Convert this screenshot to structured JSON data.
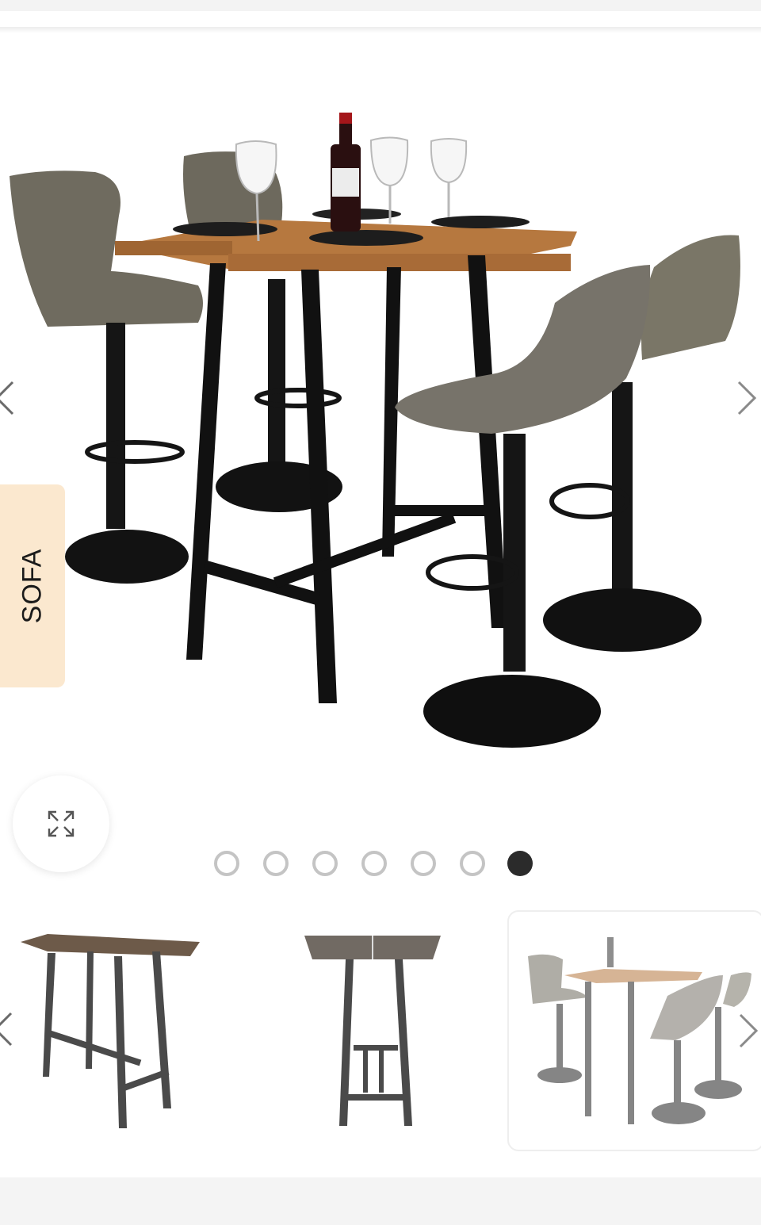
{
  "side_tab": {
    "label": "SOFA"
  },
  "gallery": {
    "total_images": 7,
    "active_index": 6
  },
  "thumbnails": [
    {
      "name": "bar-table-angled"
    },
    {
      "name": "bar-table-side"
    },
    {
      "name": "bar-table-with-stools",
      "selected": true
    }
  ],
  "colors": {
    "side_tab_bg": "#fbe8cf",
    "active_dot": "#2b2b2b",
    "inactive_dot": "#c4c4c4",
    "wood": "#b6783f",
    "seat": "#6f6b5f"
  },
  "icons": {
    "prev": "chevron-left-icon",
    "next": "chevron-right-icon",
    "expand": "expand-icon"
  }
}
